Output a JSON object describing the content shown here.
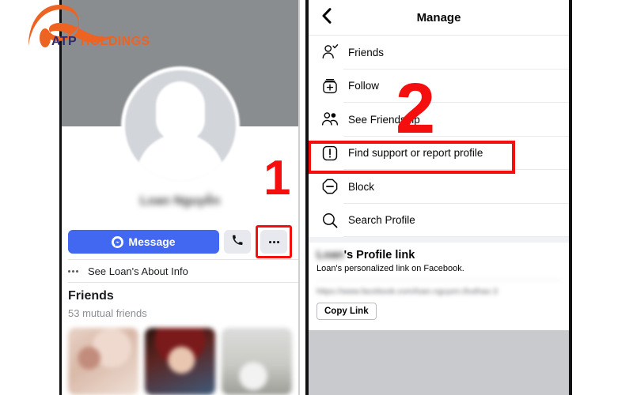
{
  "watermark": {
    "brand_part1": "ATP",
    "brand_part2": "HOLDINGS",
    "color_primary": "#ec6322",
    "color_secondary": "#2f2a6b"
  },
  "annotations": {
    "step_one": "1",
    "step_two": "2",
    "color": "#f50e0e"
  },
  "left_panel": {
    "profile_name": "Loan Nguyễn",
    "actions": {
      "message_label": "Message",
      "call_icon": "phone-icon",
      "more_icon": "ellipsis-icon"
    },
    "about_row": {
      "icon": "ellipsis-icon",
      "label": "See Loan's About Info"
    },
    "friends_section": {
      "heading": "Friends",
      "mutual": "53 mutual friends",
      "thumbnails": [
        "friend-photo-1",
        "friend-photo-2",
        "friend-photo-3"
      ]
    },
    "colors": {
      "cover": "#8a8d90",
      "message_button": "#4267f0",
      "secondary_button": "#e7e9ee"
    }
  },
  "right_panel": {
    "header": {
      "back_icon": "chevron-left-icon",
      "title": "Manage"
    },
    "menu_items": [
      {
        "icon": "person-check-icon",
        "label": "Friends"
      },
      {
        "icon": "follow-plus-icon",
        "label": "Follow"
      },
      {
        "icon": "two-people-icon",
        "label": "See Friendship"
      },
      {
        "icon": "exclamation-square-icon",
        "label": "Find support or report profile"
      },
      {
        "icon": "block-octagon-icon",
        "label": "Block"
      },
      {
        "icon": "search-icon",
        "label": "Search Profile"
      }
    ],
    "highlighted_item_index": 3,
    "profile_link": {
      "heading_name": "Loan",
      "heading_suffix": "'s Profile link",
      "subtitle": "Loan's personalized link on Facebook.",
      "url": "https://www.facebook.com/loan.nguyen.thuthao.3",
      "copy_button_label": "Copy Link"
    },
    "footer_color": "#c9cacd"
  }
}
